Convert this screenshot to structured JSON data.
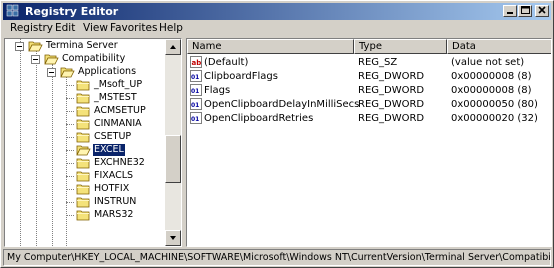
{
  "window": {
    "title": "Registry Editor"
  },
  "menu": [
    "Registry",
    "Edit",
    "View",
    "Favorites",
    "Help"
  ],
  "tree": {
    "items": [
      {
        "label": "Termina Server",
        "kind": "expanded"
      },
      {
        "label": "Compatibility",
        "kind": "expanded"
      },
      {
        "label": "Applications",
        "kind": "expanded"
      },
      {
        "label": "_Msoft_UP",
        "kind": "leaf"
      },
      {
        "label": "_MSTEST",
        "kind": "leaf"
      },
      {
        "label": "ACMSETUP",
        "kind": "leaf"
      },
      {
        "label": "CINMANIA",
        "kind": "leaf"
      },
      {
        "label": "CSETUP",
        "kind": "leaf"
      },
      {
        "label": "EXCEL",
        "kind": "selected"
      },
      {
        "label": "EXCHNE32",
        "kind": "leaf"
      },
      {
        "label": "FIXACLS",
        "kind": "leaf"
      },
      {
        "label": "HOTFIX",
        "kind": "leaf"
      },
      {
        "label": "INSTRUN",
        "kind": "leaf"
      },
      {
        "label": "MARS32",
        "kind": "leaf"
      }
    ]
  },
  "list": {
    "columns": [
      "Name",
      "Type",
      "Data"
    ],
    "rows": [
      {
        "name": "(Default)",
        "type": "REG_SZ",
        "data": "(value not set)",
        "icon": "string-value-icon"
      },
      {
        "name": "ClipboardFlags",
        "type": "REG_DWORD",
        "data": "0x00000008 (8)",
        "icon": "dword-value-icon"
      },
      {
        "name": "Flags",
        "type": "REG_DWORD",
        "data": "0x00000008 (8)",
        "icon": "dword-value-icon"
      },
      {
        "name": "OpenClipboardDelayInMilliSecs",
        "type": "REG_DWORD",
        "data": "0x00000050 (80)",
        "icon": "dword-value-icon"
      },
      {
        "name": "OpenClipboardRetries",
        "type": "REG_DWORD",
        "data": "0x00000020 (32)",
        "icon": "dword-value-icon"
      }
    ]
  },
  "status": {
    "path": "My Computer\\HKEY_LOCAL_MACHINE\\SOFTWARE\\Microsoft\\Windows NT\\CurrentVersion\\Terminal Server\\Compatibility\\Applicati"
  },
  "colors": {
    "title_start": "#0a246a",
    "title_end": "#a6caf0",
    "selection": "#0a246a",
    "folder": "#f4e27a"
  }
}
